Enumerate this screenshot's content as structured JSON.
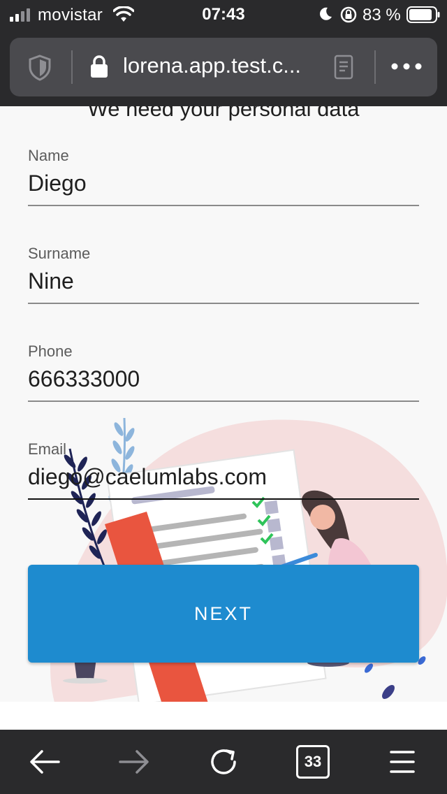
{
  "status_bar": {
    "carrier": "movistar",
    "time": "07:43",
    "battery": "83 %"
  },
  "browser": {
    "url": "lorena.app.test.c..."
  },
  "page": {
    "heading": "We need your personal data",
    "fields": [
      {
        "label": "Name",
        "value": "Diego"
      },
      {
        "label": "Surname",
        "value": "Nine"
      },
      {
        "label": "Phone",
        "value": "666333000"
      },
      {
        "label": "Email",
        "value": "diego@caelumlabs.com"
      }
    ],
    "next_label": "NEXT",
    "colors": {
      "primary_button": "#1e8bcf",
      "blob": "#f5dede",
      "accent_red": "#e9553f"
    }
  },
  "toolbar": {
    "tab_count": "33"
  }
}
